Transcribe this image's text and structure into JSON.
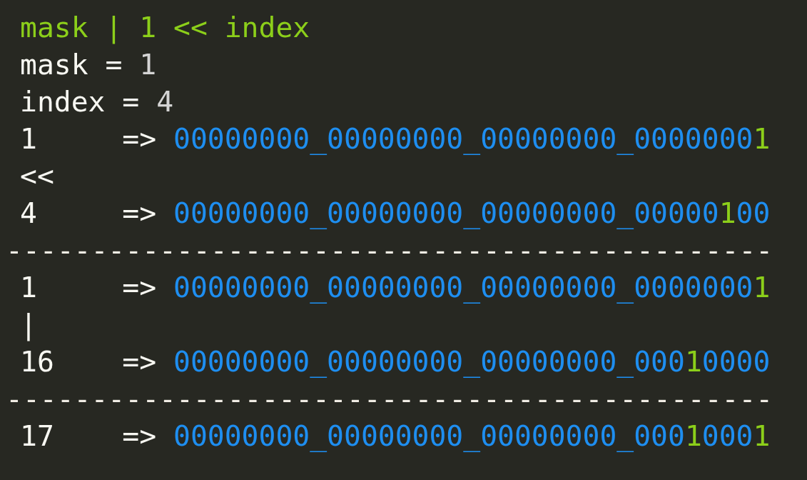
{
  "lines": [
    {
      "segments": [
        {
          "text": "mask | 1 << index",
          "kind": "accent"
        }
      ]
    },
    {
      "segments": [
        {
          "text": "mask = ",
          "kind": "plain"
        },
        {
          "text": "1",
          "kind": "number"
        }
      ]
    },
    {
      "segments": [
        {
          "text": "index = ",
          "kind": "plain"
        },
        {
          "text": "4",
          "kind": "number"
        }
      ]
    },
    {
      "segments": [
        {
          "text": "1     => ",
          "kind": "plain"
        },
        {
          "text": "00000000_00000000_00000000_0000000",
          "kind": "bits"
        },
        {
          "text": "1",
          "kind": "accent"
        }
      ]
    },
    {
      "segments": [
        {
          "text": "<<",
          "kind": "plain"
        }
      ]
    },
    {
      "segments": [
        {
          "text": "4     => ",
          "kind": "plain"
        },
        {
          "text": "00000000_00000000_00000000_00000",
          "kind": "bits"
        },
        {
          "text": "1",
          "kind": "accent"
        },
        {
          "text": "00",
          "kind": "bits"
        }
      ]
    },
    {
      "segments": [
        {
          "text": "---------------------------------------------",
          "kind": "rule"
        }
      ]
    },
    {
      "segments": [
        {
          "text": "1     => ",
          "kind": "plain"
        },
        {
          "text": "00000000_00000000_00000000_0000000",
          "kind": "bits"
        },
        {
          "text": "1",
          "kind": "accent"
        }
      ]
    },
    {
      "segments": [
        {
          "text": "|",
          "kind": "plain"
        }
      ]
    },
    {
      "segments": [
        {
          "text": "16    => ",
          "kind": "plain"
        },
        {
          "text": "00000000_00000000_00000000_000",
          "kind": "bits"
        },
        {
          "text": "1",
          "kind": "accent"
        },
        {
          "text": "0000",
          "kind": "bits"
        }
      ]
    },
    {
      "segments": [
        {
          "text": "---------------------------------------------",
          "kind": "rule"
        }
      ]
    },
    {
      "segments": [
        {
          "text": "17    => ",
          "kind": "plain"
        },
        {
          "text": "00000000_00000000_00000000_000",
          "kind": "bits"
        },
        {
          "text": "1",
          "kind": "accent"
        },
        {
          "text": "000",
          "kind": "bits"
        },
        {
          "text": "1",
          "kind": "accent"
        }
      ]
    }
  ]
}
